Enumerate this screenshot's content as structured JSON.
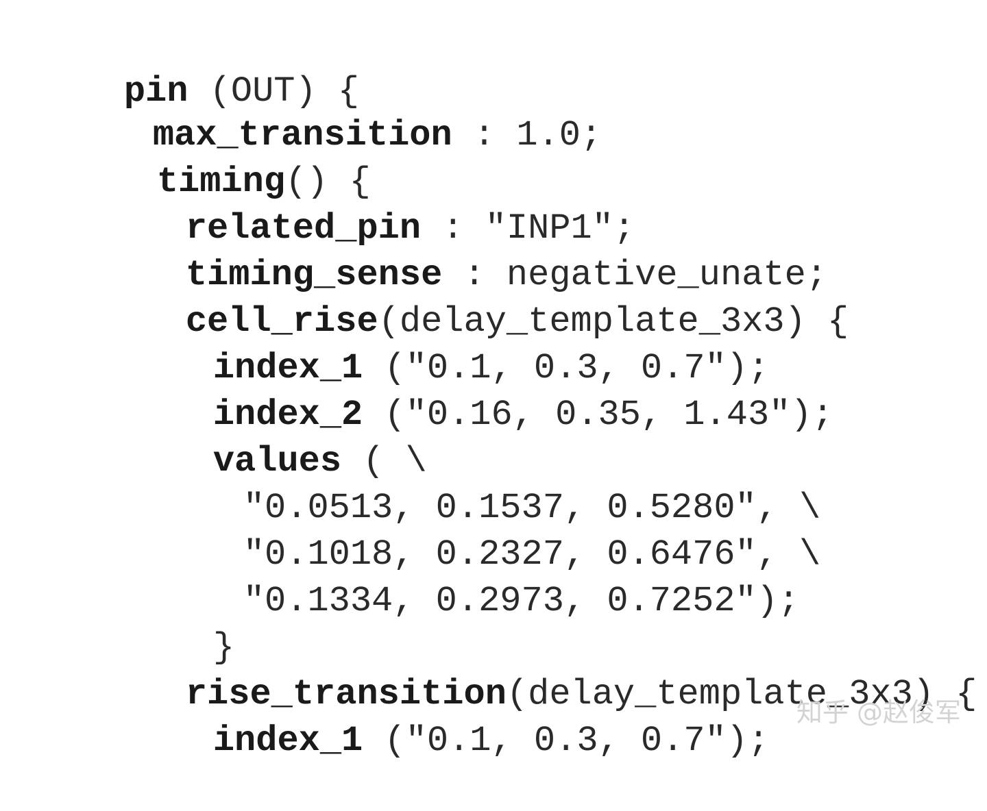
{
  "code": {
    "lines": [
      {
        "kw": "pin",
        "rest": " (OUT) {"
      },
      {
        "kw": "max_transition",
        "rest": " : 1.0;"
      },
      {
        "kw": "timing",
        "rest": "() {"
      },
      {
        "kw": "related_pin",
        "rest": " : \"INP1\";"
      },
      {
        "kw": "timing_sense",
        "rest": " : negative_unate;"
      },
      {
        "kw": "cell_rise",
        "rest": "(delay_template_3x3) {"
      },
      {
        "kw": "index_1",
        "rest": " (\"0.1, 0.3, 0.7\");"
      },
      {
        "kw": "index_2",
        "rest": " (\"0.16, 0.35, 1.43\");"
      },
      {
        "kw": "values",
        "rest": " ( \\"
      },
      {
        "kw": "",
        "rest": "\"0.0513, 0.1537, 0.5280\", \\"
      },
      {
        "kw": "",
        "rest": "\"0.1018, 0.2327, 0.6476\", \\"
      },
      {
        "kw": "",
        "rest": "\"0.1334, 0.2973, 0.7252\");"
      },
      {
        "kw": "",
        "rest": "}"
      },
      {
        "kw": "rise_transition",
        "rest": "(delay_template_3x3) {"
      },
      {
        "kw": "index_1",
        "rest": " (\"0.1, 0.3, 0.7\");"
      }
    ]
  },
  "watermark": "知乎 @赵俊军"
}
